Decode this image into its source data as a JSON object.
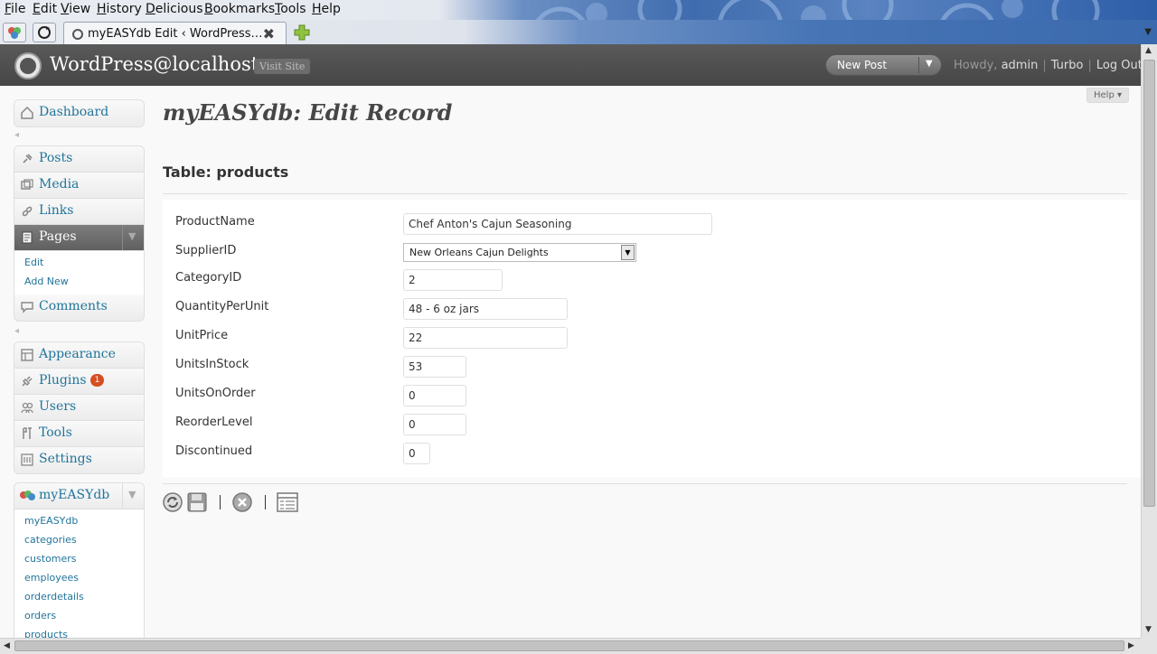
{
  "browser": {
    "menu": [
      "File",
      "Edit",
      "View",
      "History",
      "Delicious",
      "Bookmarks",
      "Tools",
      "Help"
    ],
    "tab_title": "myEASYdb Edit ‹ WordPress…"
  },
  "header": {
    "site_title": "WordPress@localhost",
    "visit_site": "Visit Site",
    "new_post": "New Post",
    "howdy": "Howdy,",
    "user": "admin",
    "turbo": "Turbo",
    "logout": "Log Out"
  },
  "sidebar": {
    "dashboard": "Dashboard",
    "posts": "Posts",
    "media": "Media",
    "links": "Links",
    "pages": "Pages",
    "pages_sub": [
      "Edit",
      "Add New"
    ],
    "comments": "Comments",
    "appearance": "Appearance",
    "plugins": "Plugins",
    "plugins_badge": "1",
    "users": "Users",
    "tools": "Tools",
    "settings": "Settings",
    "myeasydb": "myEASYdb",
    "myeasydb_sub": [
      "myEASYdb",
      "categories",
      "customers",
      "employees",
      "orderdetails",
      "orders",
      "products"
    ]
  },
  "main": {
    "help": "Help",
    "page_title": "myEASYdb: Edit Record",
    "table_title": "Table: products",
    "fields": [
      {
        "label": "ProductName",
        "value": "Chef Anton's Cajun Seasoning"
      },
      {
        "label": "SupplierID",
        "value": "New Orleans Cajun Delights"
      },
      {
        "label": "CategoryID",
        "value": "2"
      },
      {
        "label": "QuantityPerUnit",
        "value": "48 - 6 oz jars"
      },
      {
        "label": "UnitPrice",
        "value": "22"
      },
      {
        "label": "UnitsInStock",
        "value": "53"
      },
      {
        "label": "UnitsOnOrder",
        "value": "0"
      },
      {
        "label": "ReorderLevel",
        "value": "0"
      },
      {
        "label": "Discontinued",
        "value": "0"
      }
    ]
  },
  "icons": {
    "toolbar": [
      "refresh-icon",
      "save-icon",
      "cancel-icon",
      "list-icon"
    ]
  },
  "colors": {
    "link": "#21759b",
    "header_bg": "#464646",
    "badge": "#d54e21"
  }
}
